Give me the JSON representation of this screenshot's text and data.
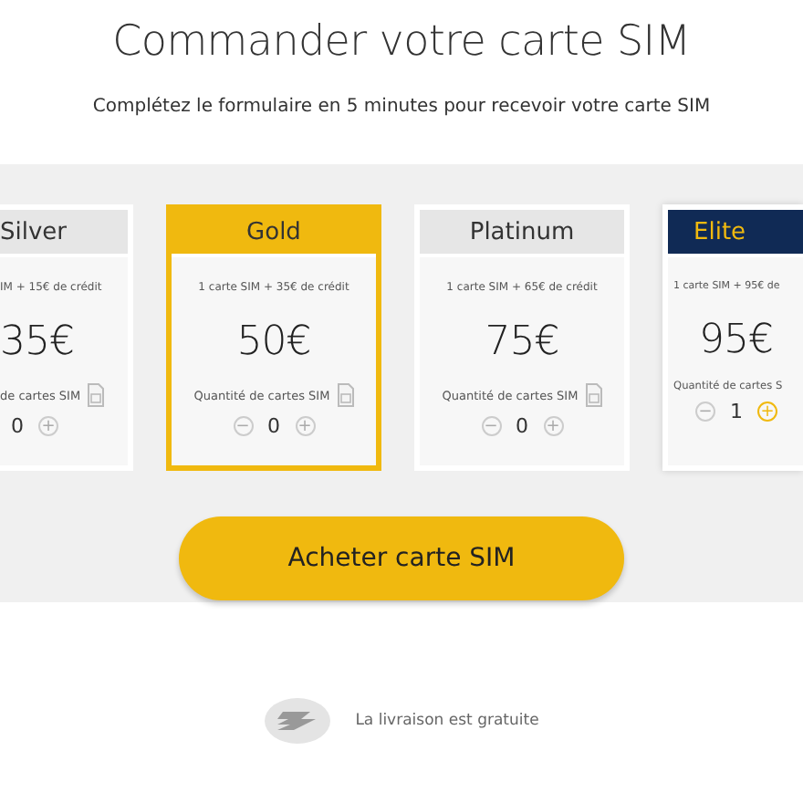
{
  "title": "Commander votre carte SIM",
  "subtitle": "Complétez le formulaire en 5 minutes pour recevoir votre carte SIM",
  "plans": [
    {
      "name": "Silver",
      "kind": "plain",
      "selected": false,
      "credit": "IM + 15€ de crédit",
      "price": "35€",
      "quantity_label": "de cartes SIM",
      "plus": "+",
      "quantity": "0",
      "plus_active": false
    },
    {
      "name": "Gold",
      "kind": "gold",
      "selected": true,
      "credit": "1 carte SIM + 35€ de crédit",
      "price": "50€",
      "quantity_label": "Quantité de cartes SIM",
      "minus": "−",
      "quantity": "0",
      "plus": "+",
      "plus_active": false
    },
    {
      "name": "Platinum",
      "kind": "plain",
      "selected": false,
      "credit": "1 carte SIM + 65€ de crédit",
      "price": "75€",
      "quantity_label": "Quantité de cartes SIM",
      "minus": "−",
      "quantity": "0",
      "plus": "+",
      "plus_active": false
    },
    {
      "name": "Elite",
      "kind": "dark",
      "selected": false,
      "credit": "1 carte SIM + 95€ de",
      "price": "95€",
      "quantity_label": "Quantité de cartes S",
      "minus": "−",
      "quantity": "1",
      "plus": "+",
      "plus_active": true
    }
  ],
  "buy_button": "Acheter carte SIM",
  "delivery": "La livraison est gratuite"
}
